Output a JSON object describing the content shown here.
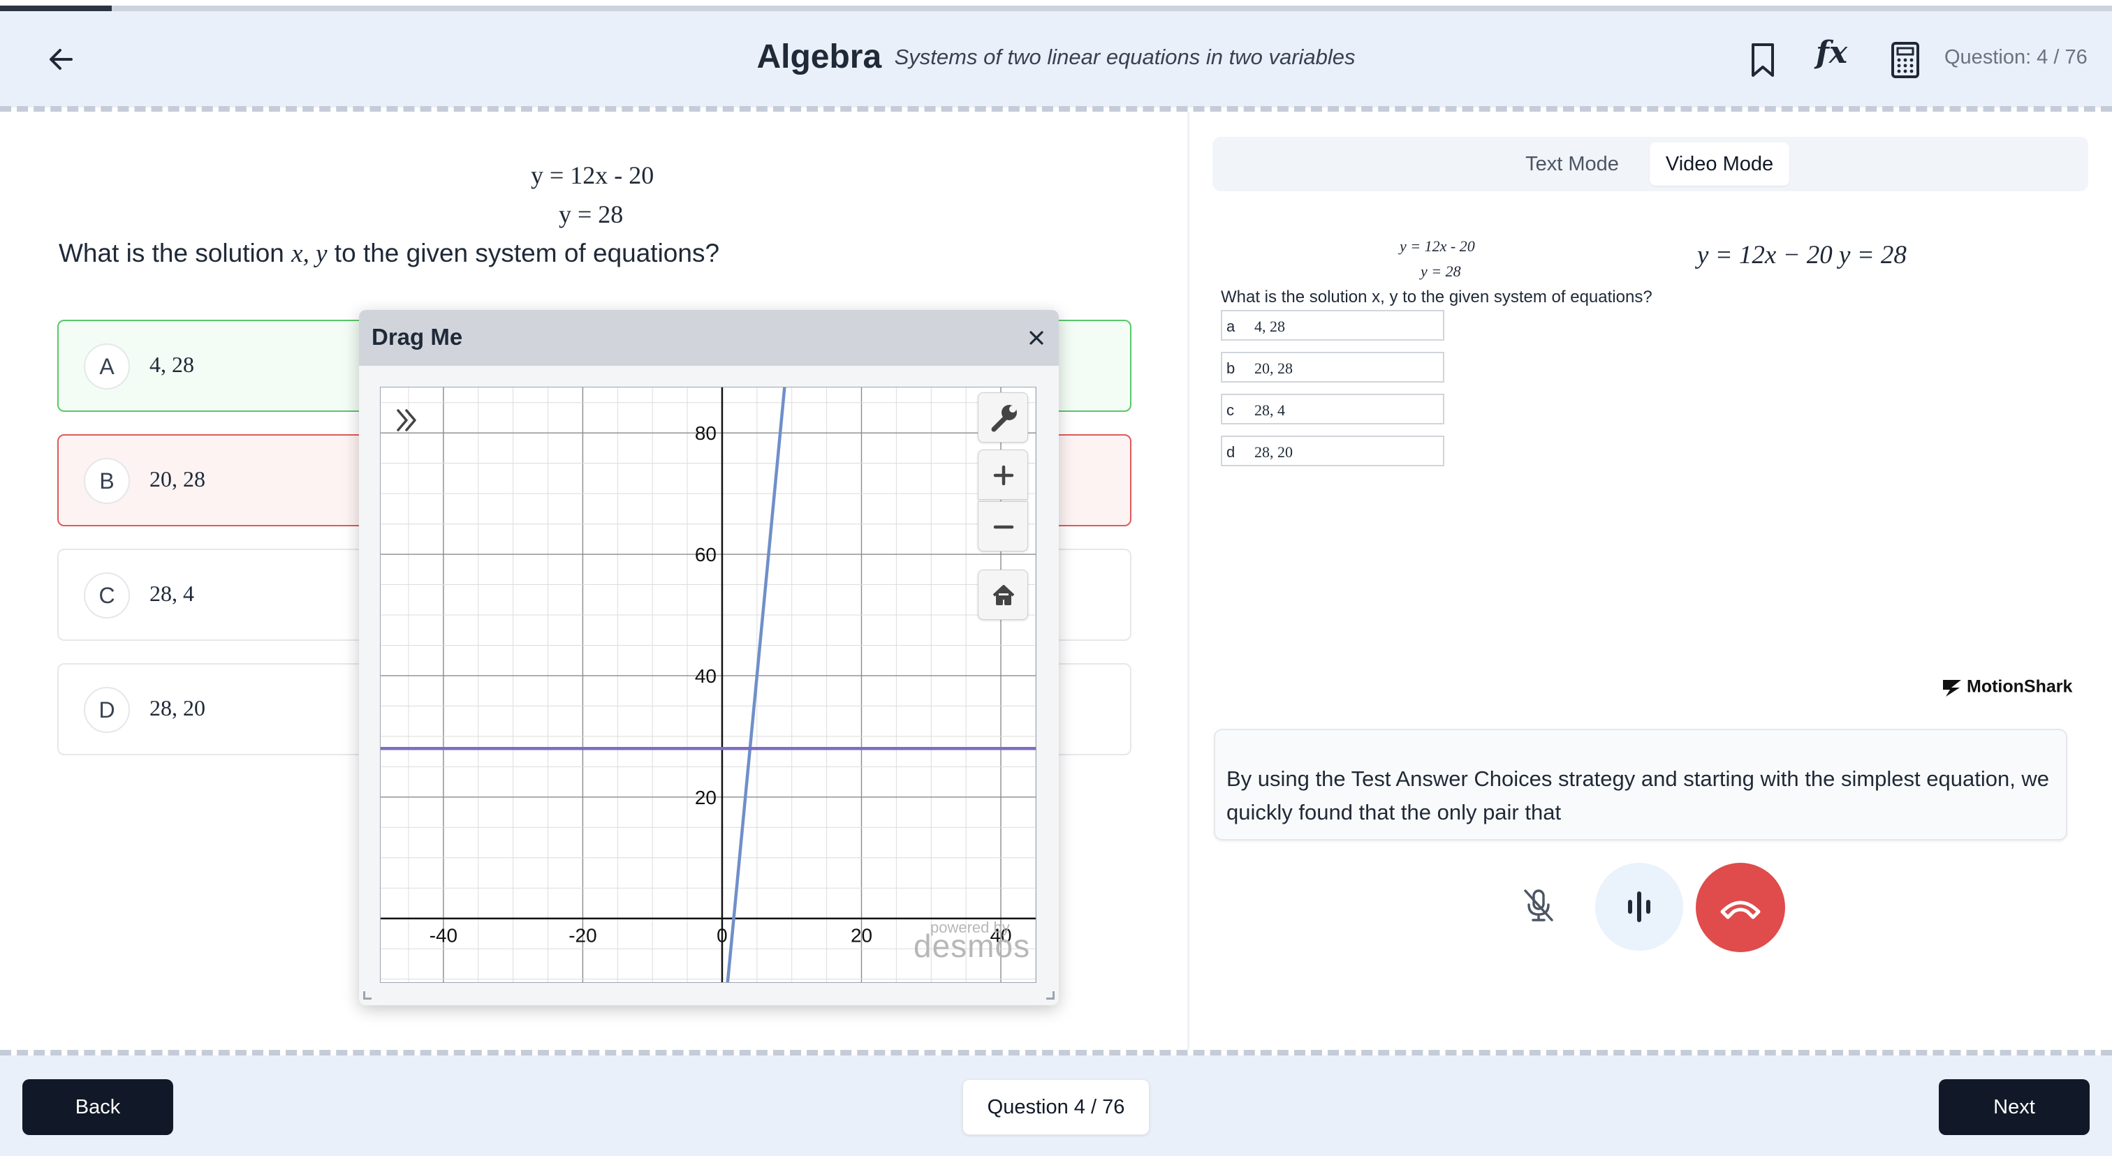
{
  "progress": {
    "fraction": 0.053
  },
  "header": {
    "back_icon": "arrow-left-icon",
    "subject": "Algebra",
    "topic": "Systems of two linear equations in two variables",
    "bookmark_icon": "bookmark-icon",
    "formula_icon_label": "fx",
    "calculator_icon": "calculator-icon",
    "question_counter": "Question: 4 / 76"
  },
  "question": {
    "equation_1": "y = 12x - 20",
    "equation_2": "y = 28",
    "prompt_before": "What is the solution ",
    "prompt_math": "x, y",
    "prompt_after": " to the given system of equations?",
    "choices": [
      {
        "letter": "A",
        "value": "4, 28",
        "state": "correct"
      },
      {
        "letter": "B",
        "value": "20, 28",
        "state": "incorrect"
      },
      {
        "letter": "C",
        "value": "28, 4",
        "state": "neutral"
      },
      {
        "letter": "D",
        "value": "28, 20",
        "state": "neutral"
      }
    ]
  },
  "graph_popup": {
    "title": "Drag Me",
    "close_icon": "close-icon",
    "powered_by": "powered by",
    "logo_text": "desmos",
    "buttons": [
      "wrench-icon",
      "plus-icon",
      "minus-icon",
      "home-icon"
    ],
    "expand_icon": "double-chevron-right-icon"
  },
  "chart_data": {
    "type": "line",
    "title": "",
    "xlabel": "",
    "ylabel": "",
    "xlim": [
      -49,
      45
    ],
    "ylim": [
      -10.5,
      87.5
    ],
    "x_ticks": [
      -40,
      -20,
      0,
      20,
      40
    ],
    "y_ticks": [
      20,
      40,
      60,
      80
    ],
    "x_tick_labels": [
      "-40",
      "-20",
      "0",
      "20",
      "40"
    ],
    "y_tick_labels": [
      "20",
      "40",
      "60",
      "80"
    ],
    "major_grid_step": 20,
    "minor_grid_step": 5,
    "grid": true,
    "series": [
      {
        "slope": 12,
        "intercept": -20,
        "color": "#6f8fc9"
      },
      {
        "slope": 0,
        "intercept": 28,
        "color": "#7e6cc4"
      }
    ]
  },
  "right_panel": {
    "mode_tabs": {
      "text_mode": "Text Mode",
      "video_mode": "Video Mode",
      "active": "Video Mode"
    },
    "video": {
      "equation_1": "y = 12x - 20",
      "equation_2": "y = 28",
      "question": "What is the solution x, y to the given system of equations?",
      "combined_equation": "y = 12x − 20 y = 28",
      "choices": [
        {
          "letter": "a",
          "value": "4, 28"
        },
        {
          "letter": "b",
          "value": "20, 28"
        },
        {
          "letter": "c",
          "value": "28, 4"
        },
        {
          "letter": "d",
          "value": "28, 20"
        }
      ],
      "brand": "MotionShark"
    },
    "transcript": "By using the Test Answer Choices strategy and starting with the simplest equation, we quickly found that the only pair that",
    "controls": {
      "mute_icon": "mic-off-icon",
      "voice_icon": "voice-activity-icon",
      "hangup_icon": "phone-hangup-icon"
    }
  },
  "footer": {
    "back_label": "Back",
    "question_counter": "Question 4 / 76",
    "next_label": "Next"
  },
  "colors": {
    "header_bg": "#eaf0f9",
    "correct_border": "#58c76a",
    "incorrect_border": "#e05a5a",
    "hangup": "#e04b4b",
    "button_dark": "#111827"
  }
}
